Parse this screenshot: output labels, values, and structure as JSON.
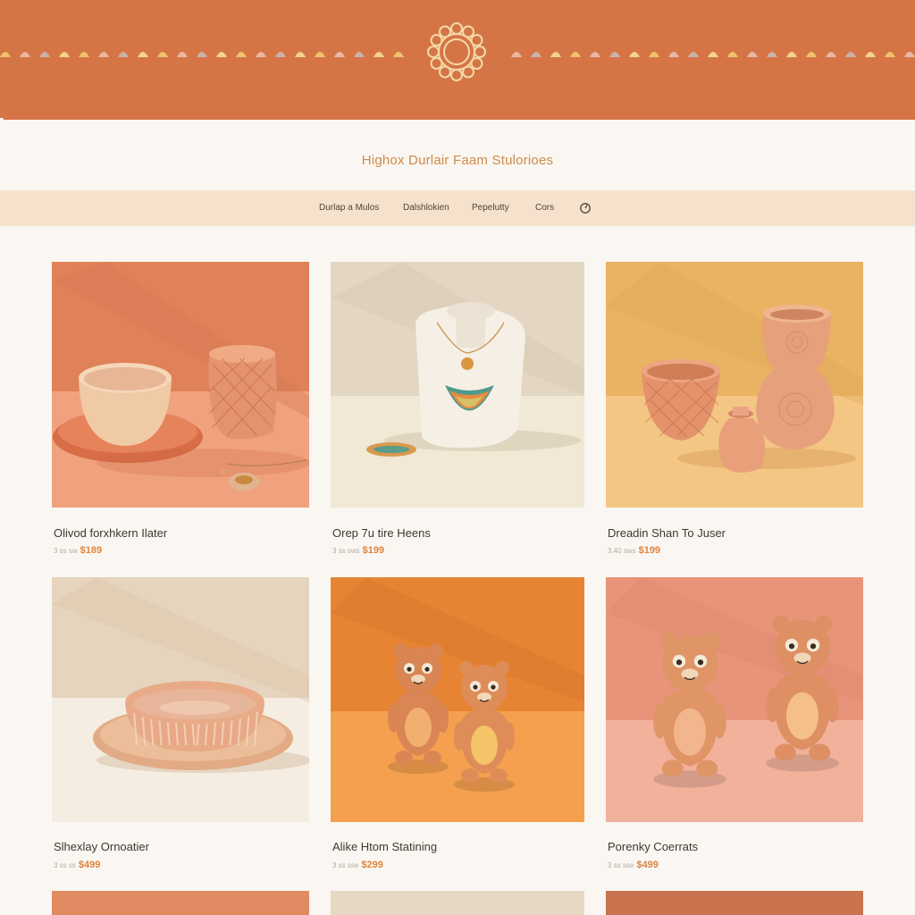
{
  "shop": {
    "title": "Highox Durlair Faam Stulorioes"
  },
  "nav": {
    "items": [
      "Durlap a Mulos",
      "Dalshlokien",
      "Pepelutty",
      "Cors"
    ]
  },
  "products": [
    {
      "name": "Olivod forxhkern Ilater",
      "small": "3 ss sw",
      "price": "$189"
    },
    {
      "name": "Orep 7u tire Heens",
      "small": "3 ss sws",
      "price": "$199"
    },
    {
      "name": "Dreadin Shan To Juser",
      "small": "3.40 sws",
      "price": "$199"
    },
    {
      "name": "Slhexlay Ornoatier",
      "small": "3 ss ss",
      "price": "$499"
    },
    {
      "name": "Alike Htom Statining",
      "small": "3 ss sse",
      "price": "$299"
    },
    {
      "name": "Porenky Coerrats",
      "small": "3 ss sse",
      "price": "$499"
    }
  ],
  "colors": {
    "banner": "#d57546",
    "nav_band": "#f6e1cc",
    "price": "#e0833f",
    "title": "#cf8a4b"
  },
  "icons": {
    "logo": "sun-mandala-icon",
    "search": "search-icon"
  }
}
